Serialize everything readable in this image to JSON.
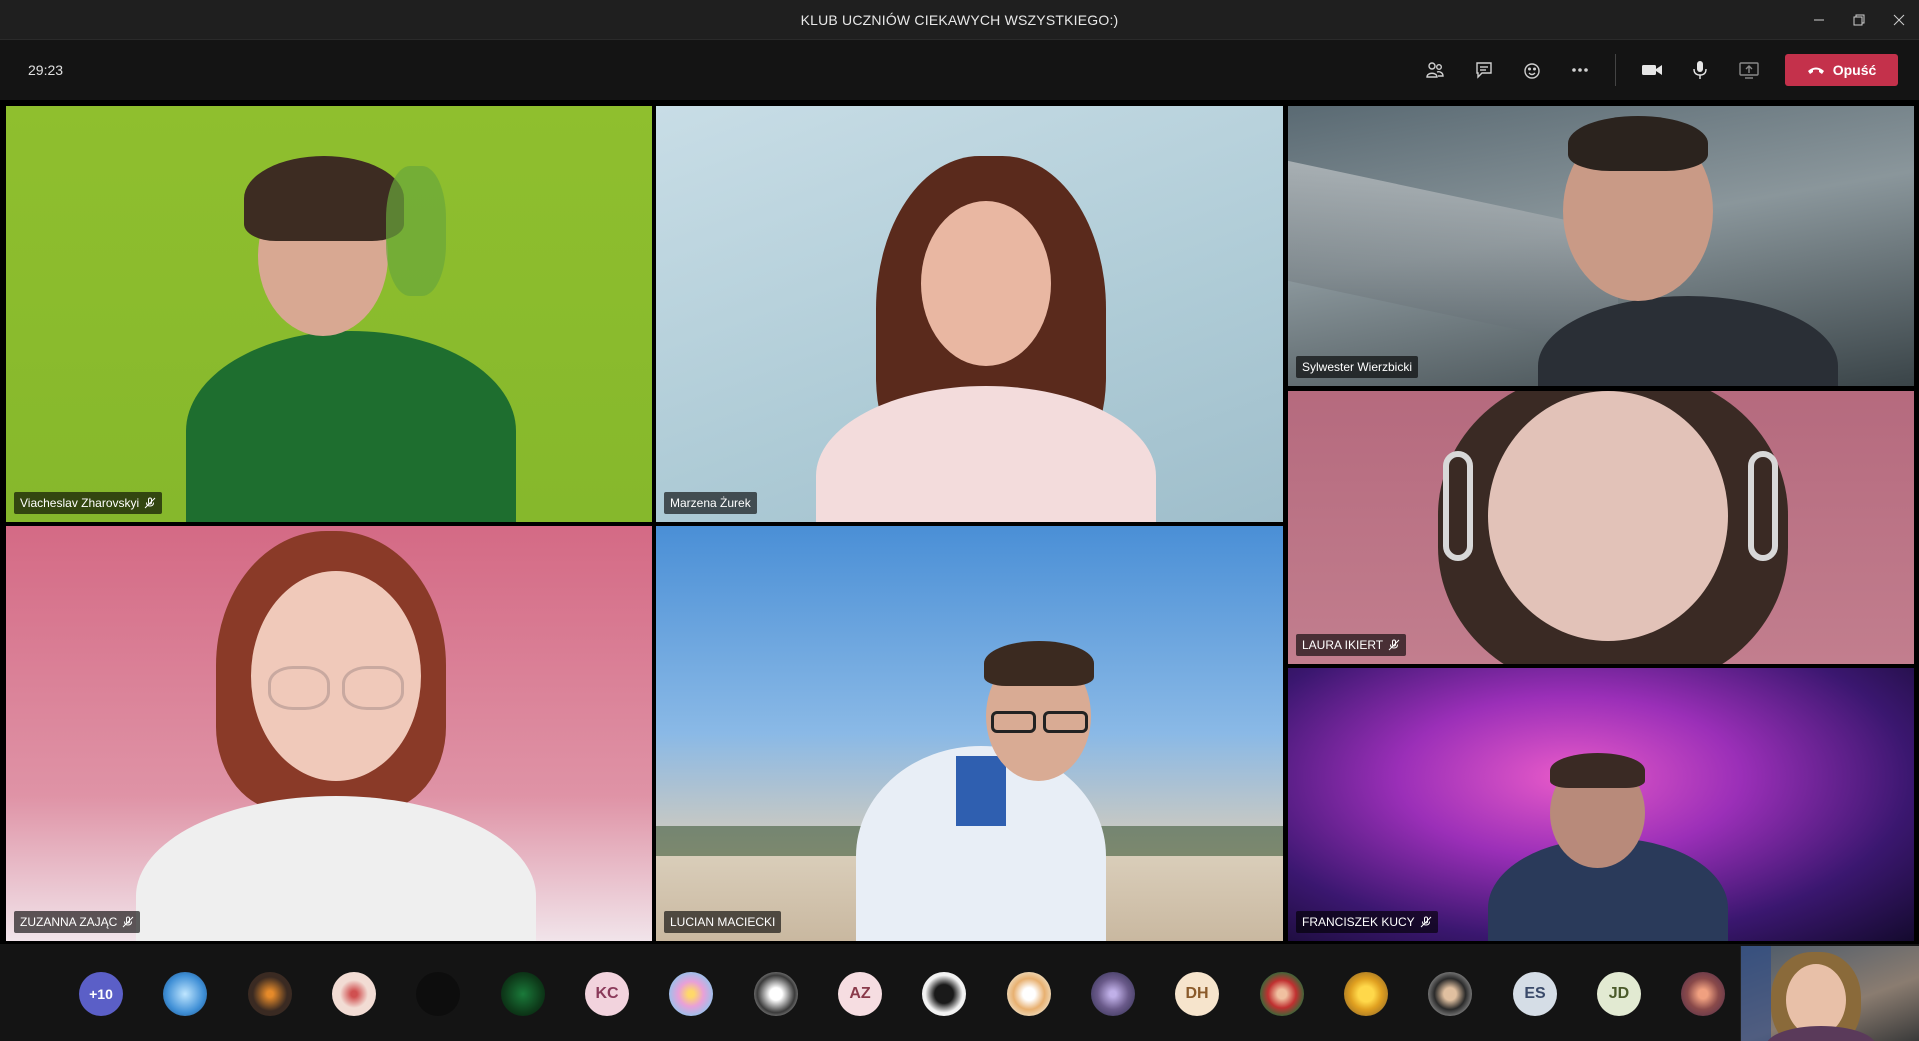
{
  "window": {
    "title": "KLUB UCZNIÓW CIEKAWYCH WSZYSTKIEGO:)",
    "controls": [
      "minimize-icon",
      "restore-icon",
      "close-icon"
    ]
  },
  "toolbar": {
    "timer": "29:23",
    "icons": [
      "participants-icon",
      "chat-icon",
      "reactions-icon",
      "more-icon",
      "camera-icon",
      "microphone-icon",
      "share-screen-icon"
    ],
    "leave_label": "Opuść",
    "leave_color": "#c4314b"
  },
  "participants": {
    "tile1": {
      "name": "Viacheslav Zharovskyi",
      "muted": true
    },
    "tile2": {
      "name": "Marzena Żurek",
      "muted": false
    },
    "tile3": {
      "name": "Sylwester Wierzbicki",
      "muted": false
    },
    "tile4": {
      "name": "LAURA IKIERT",
      "muted": true
    },
    "tile5": {
      "name": "ZUZANNA ZAJĄC",
      "muted": true
    },
    "tile6": {
      "name": "LUCIAN MACIECKI",
      "muted": false
    },
    "tile7": {
      "name": "FRANCISZEK KUCY",
      "muted": true
    }
  },
  "roster": {
    "overflow": "+10",
    "avatars": [
      {
        "initials": "+10",
        "color": "#5b5fc7"
      },
      {
        "initials": "",
        "color": "#3f8fd6"
      },
      {
        "initials": "",
        "color": "#3a2a22"
      },
      {
        "initials": "",
        "color": "#f2dcd4"
      },
      {
        "initials": "",
        "color": "#0d0d0d"
      },
      {
        "initials": "",
        "color": "#0e3b1a"
      },
      {
        "initials": "KC",
        "color": "#f2d3dd"
      },
      {
        "initials": "",
        "color": "#e8c2e0"
      },
      {
        "initials": "",
        "color": "#e6e6e6"
      },
      {
        "initials": "AZ",
        "color": "#f6dde1"
      },
      {
        "initials": "",
        "color": "#f2f2f2"
      },
      {
        "initials": "",
        "color": "#f0e2c8"
      },
      {
        "initials": "",
        "color": "#6a5a8a"
      },
      {
        "initials": "DH",
        "color": "#f6e4cc"
      },
      {
        "initials": "",
        "color": "#2b6e3a"
      },
      {
        "initials": "",
        "color": "#7a5a2a"
      },
      {
        "initials": "",
        "color": "#d8d8d8"
      },
      {
        "initials": "ES",
        "color": "#d5dde6"
      },
      {
        "initials": "JD",
        "color": "#e2ead2"
      },
      {
        "initials": "",
        "color": "#8a4a4a"
      }
    ]
  }
}
